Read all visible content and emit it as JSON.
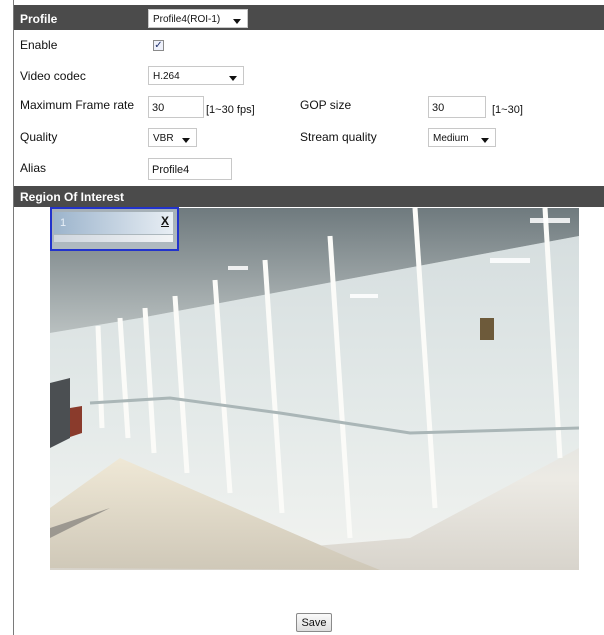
{
  "profile": {
    "label": "Profile",
    "selected": "Profile4(ROI-1)"
  },
  "enable": {
    "label": "Enable",
    "checked": true
  },
  "video_codec": {
    "label": "Video codec",
    "selected": "H.264"
  },
  "frame_rate": {
    "label": "Maximum Frame rate",
    "value": "30",
    "hint": "[1~30 fps]"
  },
  "gop": {
    "label": "GOP size",
    "value": "30",
    "hint": "[1~30]"
  },
  "quality": {
    "label": "Quality",
    "selected": "VBR"
  },
  "stream_quality": {
    "label": "Stream quality",
    "selected": "Medium"
  },
  "alias": {
    "label": "Alias",
    "value": "Profile4"
  },
  "roi_section": {
    "label": "Region Of Interest"
  },
  "roi_box": {
    "number": "1",
    "close": "X"
  },
  "save_label": "Save",
  "colors": {
    "header_bar": "#4b4b4b",
    "roi_border": "#2233cc"
  }
}
